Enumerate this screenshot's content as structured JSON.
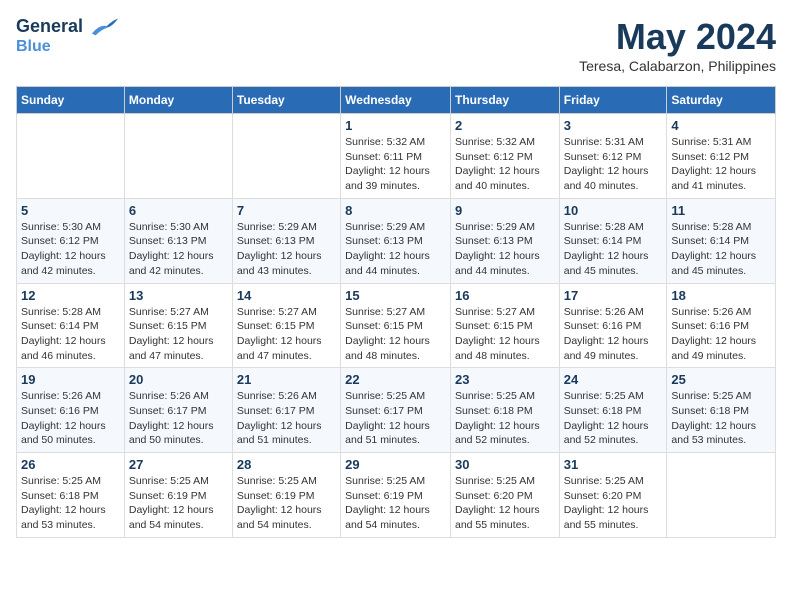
{
  "logo": {
    "line1": "General",
    "line2": "Blue"
  },
  "title": "May 2024",
  "subtitle": "Teresa, Calabarzon, Philippines",
  "days_of_week": [
    "Sunday",
    "Monday",
    "Tuesday",
    "Wednesday",
    "Thursday",
    "Friday",
    "Saturday"
  ],
  "weeks": [
    [
      {
        "day": "",
        "info": ""
      },
      {
        "day": "",
        "info": ""
      },
      {
        "day": "",
        "info": ""
      },
      {
        "day": "1",
        "info": "Sunrise: 5:32 AM\nSunset: 6:11 PM\nDaylight: 12 hours\nand 39 minutes."
      },
      {
        "day": "2",
        "info": "Sunrise: 5:32 AM\nSunset: 6:12 PM\nDaylight: 12 hours\nand 40 minutes."
      },
      {
        "day": "3",
        "info": "Sunrise: 5:31 AM\nSunset: 6:12 PM\nDaylight: 12 hours\nand 40 minutes."
      },
      {
        "day": "4",
        "info": "Sunrise: 5:31 AM\nSunset: 6:12 PM\nDaylight: 12 hours\nand 41 minutes."
      }
    ],
    [
      {
        "day": "5",
        "info": "Sunrise: 5:30 AM\nSunset: 6:12 PM\nDaylight: 12 hours\nand 42 minutes."
      },
      {
        "day": "6",
        "info": "Sunrise: 5:30 AM\nSunset: 6:13 PM\nDaylight: 12 hours\nand 42 minutes."
      },
      {
        "day": "7",
        "info": "Sunrise: 5:29 AM\nSunset: 6:13 PM\nDaylight: 12 hours\nand 43 minutes."
      },
      {
        "day": "8",
        "info": "Sunrise: 5:29 AM\nSunset: 6:13 PM\nDaylight: 12 hours\nand 44 minutes."
      },
      {
        "day": "9",
        "info": "Sunrise: 5:29 AM\nSunset: 6:13 PM\nDaylight: 12 hours\nand 44 minutes."
      },
      {
        "day": "10",
        "info": "Sunrise: 5:28 AM\nSunset: 6:14 PM\nDaylight: 12 hours\nand 45 minutes."
      },
      {
        "day": "11",
        "info": "Sunrise: 5:28 AM\nSunset: 6:14 PM\nDaylight: 12 hours\nand 45 minutes."
      }
    ],
    [
      {
        "day": "12",
        "info": "Sunrise: 5:28 AM\nSunset: 6:14 PM\nDaylight: 12 hours\nand 46 minutes."
      },
      {
        "day": "13",
        "info": "Sunrise: 5:27 AM\nSunset: 6:15 PM\nDaylight: 12 hours\nand 47 minutes."
      },
      {
        "day": "14",
        "info": "Sunrise: 5:27 AM\nSunset: 6:15 PM\nDaylight: 12 hours\nand 47 minutes."
      },
      {
        "day": "15",
        "info": "Sunrise: 5:27 AM\nSunset: 6:15 PM\nDaylight: 12 hours\nand 48 minutes."
      },
      {
        "day": "16",
        "info": "Sunrise: 5:27 AM\nSunset: 6:15 PM\nDaylight: 12 hours\nand 48 minutes."
      },
      {
        "day": "17",
        "info": "Sunrise: 5:26 AM\nSunset: 6:16 PM\nDaylight: 12 hours\nand 49 minutes."
      },
      {
        "day": "18",
        "info": "Sunrise: 5:26 AM\nSunset: 6:16 PM\nDaylight: 12 hours\nand 49 minutes."
      }
    ],
    [
      {
        "day": "19",
        "info": "Sunrise: 5:26 AM\nSunset: 6:16 PM\nDaylight: 12 hours\nand 50 minutes."
      },
      {
        "day": "20",
        "info": "Sunrise: 5:26 AM\nSunset: 6:17 PM\nDaylight: 12 hours\nand 50 minutes."
      },
      {
        "day": "21",
        "info": "Sunrise: 5:26 AM\nSunset: 6:17 PM\nDaylight: 12 hours\nand 51 minutes."
      },
      {
        "day": "22",
        "info": "Sunrise: 5:25 AM\nSunset: 6:17 PM\nDaylight: 12 hours\nand 51 minutes."
      },
      {
        "day": "23",
        "info": "Sunrise: 5:25 AM\nSunset: 6:18 PM\nDaylight: 12 hours\nand 52 minutes."
      },
      {
        "day": "24",
        "info": "Sunrise: 5:25 AM\nSunset: 6:18 PM\nDaylight: 12 hours\nand 52 minutes."
      },
      {
        "day": "25",
        "info": "Sunrise: 5:25 AM\nSunset: 6:18 PM\nDaylight: 12 hours\nand 53 minutes."
      }
    ],
    [
      {
        "day": "26",
        "info": "Sunrise: 5:25 AM\nSunset: 6:18 PM\nDaylight: 12 hours\nand 53 minutes."
      },
      {
        "day": "27",
        "info": "Sunrise: 5:25 AM\nSunset: 6:19 PM\nDaylight: 12 hours\nand 54 minutes."
      },
      {
        "day": "28",
        "info": "Sunrise: 5:25 AM\nSunset: 6:19 PM\nDaylight: 12 hours\nand 54 minutes."
      },
      {
        "day": "29",
        "info": "Sunrise: 5:25 AM\nSunset: 6:19 PM\nDaylight: 12 hours\nand 54 minutes."
      },
      {
        "day": "30",
        "info": "Sunrise: 5:25 AM\nSunset: 6:20 PM\nDaylight: 12 hours\nand 55 minutes."
      },
      {
        "day": "31",
        "info": "Sunrise: 5:25 AM\nSunset: 6:20 PM\nDaylight: 12 hours\nand 55 minutes."
      },
      {
        "day": "",
        "info": ""
      }
    ]
  ]
}
